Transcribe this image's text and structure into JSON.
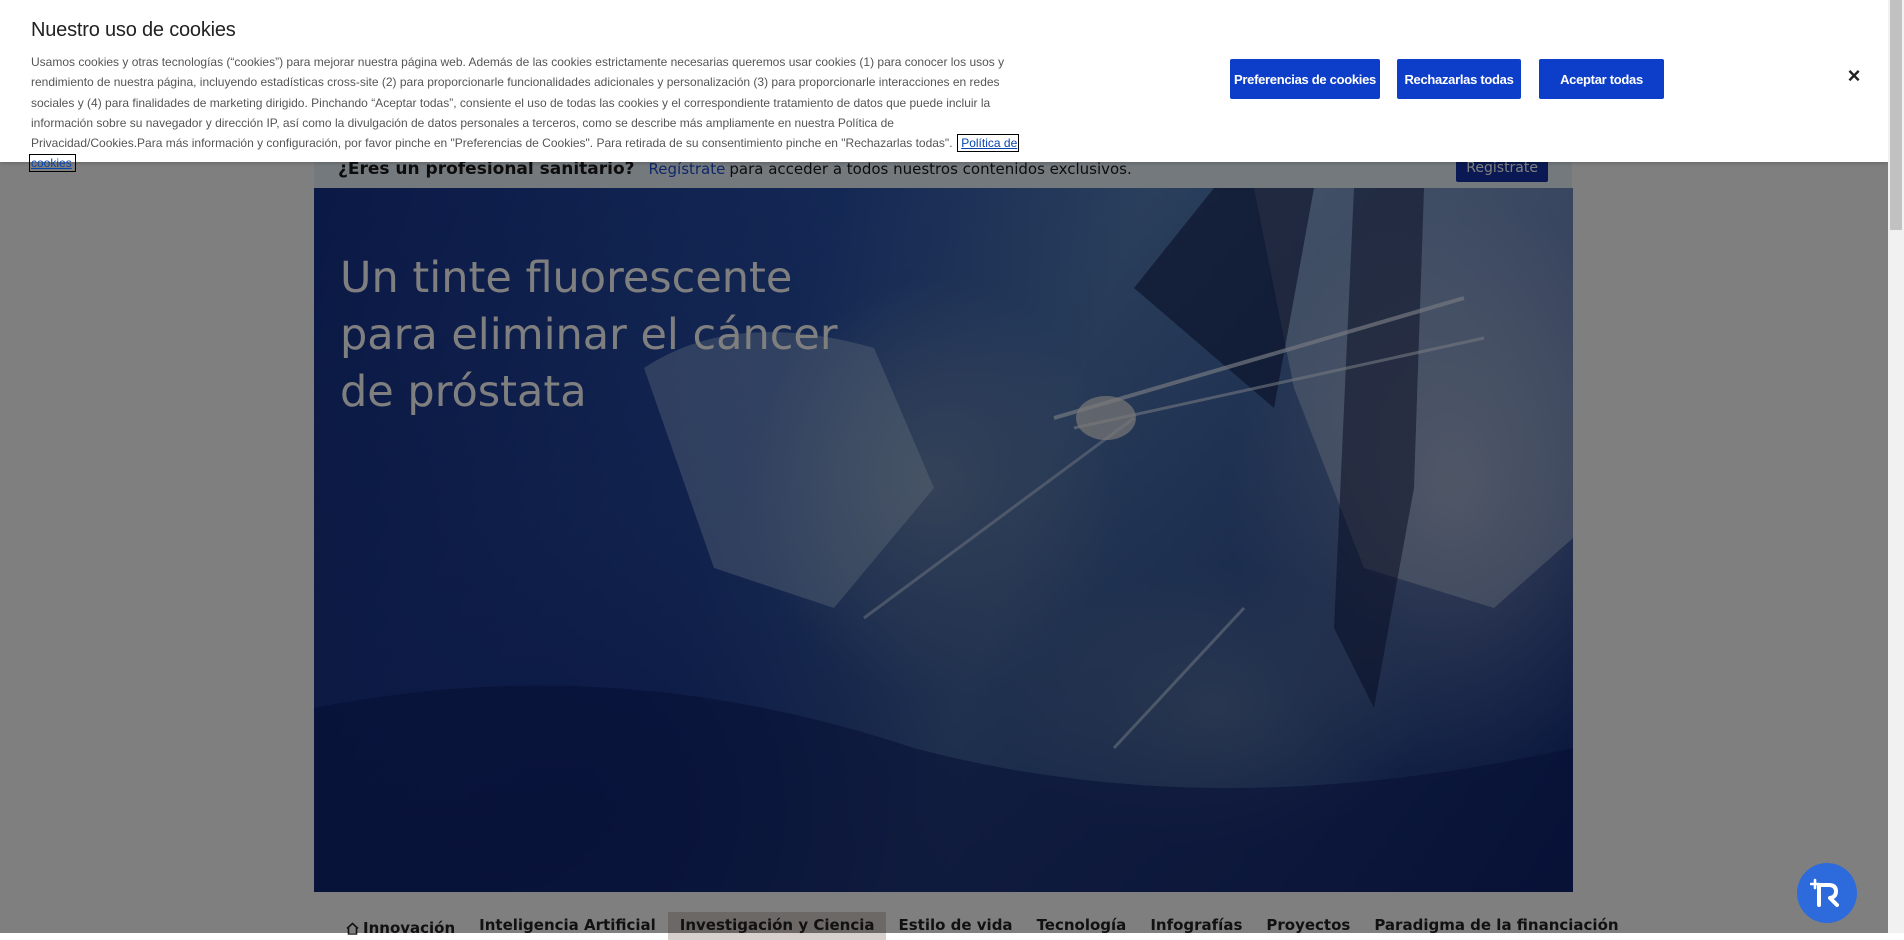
{
  "cookie_banner": {
    "title": "Nuestro uso de cookies",
    "body": "Usamos cookies y otras tecnologías (“cookies”) para mejorar nuestra página web. Además de las cookies estrictamente necesarias queremos usar cookies (1) para conocer los usos y rendimiento de nuestra página, incluyendo estadísticas cross-site (2) para proporcionarle funcionalidades adicionales y personalización (3) para proporcionarle interacciones en redes sociales y (4) para finalidades de marketing dirigido. Pinchando “Aceptar todas”, consiente el uso de todas las cookies y el correspondiente tratamiento de datos que puede incluir la información sobre su navegador y dirección IP, así como la divulgación de datos personales a terceros, como se describe más ampliamente en nuestra Política de Privacidad/Cookies.Para más información y configuración, por favor pinche en \"Preferencias de Cookies\". Para retirada de su consentimiento pinche en \"Rechazarlas todas\".",
    "policy_link": "Política de cookies",
    "buttons": {
      "preferences": "Preferencias de cookies",
      "reject": "Rechazarlas todas",
      "accept": "Aceptar todas"
    },
    "close_icon": "×"
  },
  "professional_bar": {
    "question": "¿Eres un profesional sanitario?",
    "link": "Regístrate",
    "rest": "para acceder a todos nuestros contenidos exclusivos.",
    "button": "Regístrate"
  },
  "hero": {
    "title": "Un tinte fluorescente para eliminar el cáncer de próstata"
  },
  "nav": {
    "items": [
      {
        "label": "Innovación",
        "icon": "home-icon"
      },
      {
        "label": "Inteligencia Artificial"
      },
      {
        "label": "Investigación y Ciencia",
        "active": true
      },
      {
        "label": "Estilo de vida"
      },
      {
        "label": "Tecnología"
      },
      {
        "label": "Infografías"
      },
      {
        "label": "Proyectos"
      },
      {
        "label": "Paradigma de la financiación"
      }
    ]
  },
  "colors": {
    "primary_button": "#0d3ec9",
    "overlay": "rgba(0,0,0,0.5)",
    "fab": "#2d6bdc"
  }
}
